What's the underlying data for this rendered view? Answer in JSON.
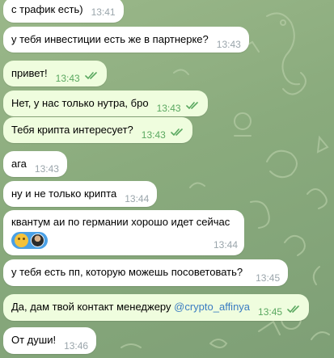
{
  "messages": [
    {
      "text": "с трафик есть)",
      "time": "13:41",
      "dir": "in"
    },
    {
      "text": "у тебя инвестиции есть же в партнерке?",
      "time": "13:43",
      "dir": "in"
    },
    {
      "text": "привет!",
      "time": "13:43",
      "dir": "out"
    },
    {
      "text": "Нет, у нас только нутра, бро",
      "time": "13:43",
      "dir": "out"
    },
    {
      "text": "Тебя крипта интересует?",
      "time": "13:43",
      "dir": "out"
    },
    {
      "text": "ага",
      "time": "13:43",
      "dir": "in"
    },
    {
      "text": "ну и не только крипта",
      "time": "13:44",
      "dir": "in"
    },
    {
      "text": "квантум аи по германии хорошо идет сейчас",
      "time": "13:44",
      "dir": "in"
    },
    {
      "text": "у тебя есть пп, которую можешь посоветовать?",
      "time": "13:45",
      "dir": "in"
    },
    {
      "text": "Да, дам твой контакт менеджеру",
      "link": "@crypto_affinya",
      "time": "13:45",
      "dir": "out"
    },
    {
      "text": "От души!",
      "time": "13:46",
      "dir": "in"
    }
  ],
  "reaction": {
    "emoji_icon": "neutral-face-emoji-icon",
    "color": "#4aa0e6"
  },
  "colors": {
    "incoming_bubble": "#ffffff",
    "outgoing_bubble": "#effdde",
    "read_checks": "#5aa860",
    "link": "#3a7cc2"
  }
}
